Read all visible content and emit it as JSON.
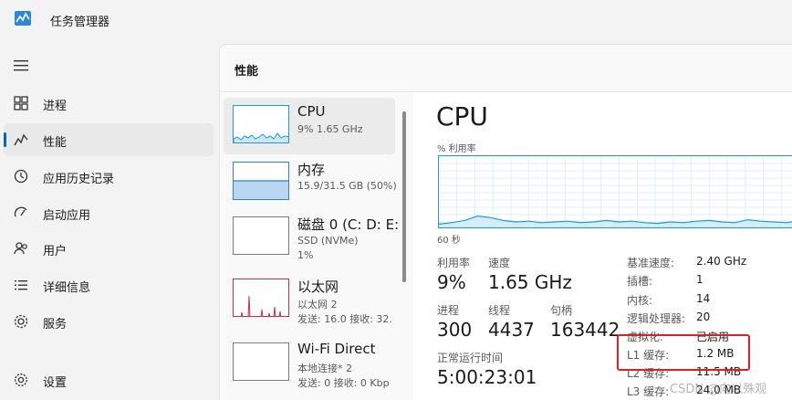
{
  "window": {
    "title": "任务管理器"
  },
  "nav": [
    {
      "label": "进程",
      "icon": "grid-icon",
      "active": false
    },
    {
      "label": "性能",
      "icon": "performance-icon",
      "active": true
    },
    {
      "label": "应用历史记录",
      "icon": "history-icon",
      "active": false
    },
    {
      "label": "启动应用",
      "icon": "startup-icon",
      "active": false
    },
    {
      "label": "用户",
      "icon": "users-icon",
      "active": false
    },
    {
      "label": "详细信息",
      "icon": "details-icon",
      "active": false
    },
    {
      "label": "服务",
      "icon": "services-icon",
      "active": false
    }
  ],
  "settings": {
    "label": "设置"
  },
  "page": {
    "title": "性能"
  },
  "devices": [
    {
      "name": "CPU",
      "sub1": "9% 1.65 GHz",
      "sub2": ""
    },
    {
      "name": "内存",
      "sub1": "15.9/31.5 GB (50%)",
      "sub2": ""
    },
    {
      "name": "磁盘 0 (C: D: E:",
      "sub1": "SSD (NVMe)",
      "sub2": "1%"
    },
    {
      "name": "以太网",
      "sub1": "以太网 2",
      "sub2": "发送: 16.0 接收: 32."
    },
    {
      "name": "Wi-Fi Direct",
      "sub1": "本地连接* 2",
      "sub2": "发送: 0 接收: 0 Kbp"
    }
  ],
  "detail": {
    "title": "CPU",
    "graph_label": "% 利用率",
    "graph_time": "60 秒",
    "utilization_label": "利用率",
    "utilization": "9%",
    "speed_label": "速度",
    "speed": "1.65 GHz",
    "processes_label": "进程",
    "processes": "300",
    "threads_label": "线程",
    "threads": "4437",
    "handles_label": "句柄",
    "handles": "163442",
    "uptime_label": "正常运行时间",
    "uptime": "5:00:23:01",
    "specs": [
      {
        "k": "基准速度:",
        "v": "2.40 GHz"
      },
      {
        "k": "插槽:",
        "v": "1"
      },
      {
        "k": "内核:",
        "v": "14"
      },
      {
        "k": "逻辑处理器:",
        "v": "20"
      },
      {
        "k": "虚拟化:",
        "v": "已启用"
      },
      {
        "k": "L1 缓存:",
        "v": "1.2 MB"
      },
      {
        "k": "L2 缓存:",
        "v": "11.5 MB"
      },
      {
        "k": "L3 缓存:",
        "v": "24.0 MB"
      }
    ]
  },
  "utilization_series": [
    7,
    9,
    12,
    18,
    16,
    12,
    10,
    11,
    9,
    10,
    11,
    9,
    10,
    12,
    10,
    11,
    9,
    8,
    10,
    9,
    11,
    12,
    10,
    9,
    13,
    11,
    10,
    9,
    12
  ],
  "watermark": "CSDN @向以殊观",
  "colors": {
    "accent": "#0067c0",
    "cpu": "#1a9bd7",
    "memory": "#2f7fd6",
    "network": "#c4314b",
    "highlight": "#e02020"
  }
}
